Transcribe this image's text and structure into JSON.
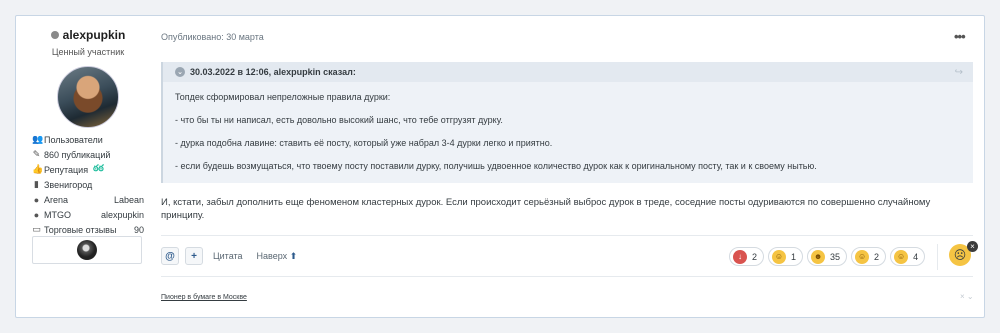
{
  "author": {
    "name": "alexpupkin",
    "title": "Ценный участник"
  },
  "stats": [
    {
      "icon": "users-icon",
      "glyph": "👥",
      "label": "Пользователи",
      "value": ""
    },
    {
      "icon": "comments-icon",
      "glyph": "✎",
      "label": "860 публикаций",
      "value": ""
    },
    {
      "icon": "thumbs-up-icon",
      "glyph": "👍",
      "label": "Репутация",
      "value": "",
      "badge": "ఠఠ"
    },
    {
      "icon": "building-icon",
      "glyph": "▮",
      "label": "Звенигород",
      "value": ""
    },
    {
      "icon": "user-icon",
      "glyph": "●",
      "label": "Arena",
      "value": "Labean"
    },
    {
      "icon": "user-icon",
      "glyph": "●",
      "label": "MTGO",
      "value": "alexpupkin"
    },
    {
      "icon": "id-card-icon",
      "glyph": "▭",
      "label": "Торговые отзывы",
      "value": "90"
    }
  ],
  "post": {
    "meta": "Опубликовано: 30 марта",
    "more": "•••",
    "quote": {
      "header": "30.03.2022 в 12:06, alexpupkin сказал:",
      "paragraphs": [
        "Топдек сформировал непреложные правила дурки:",
        "- что бы ты ни написал, есть довольно высокий шанс, что тебе отгрузят дурку.",
        "- дурка подобна лавине: ставить её посту, который уже набрал 3-4 дурки легко и приятно.",
        "- если будешь возмущаться, что твоему посту поставили дурку, получишь удвоенное количество дурок как к оригинальному посту, так и к своему нытью."
      ]
    },
    "text": "И, кстати, забыл дополнить еще феноменом кластерных дурок. Если происходит серьёзный выброс дурок в треде, соседние посты одуриваются по совершенно случайному принципу.",
    "actions": {
      "mention": "@",
      "plus": "+",
      "quote_label": "Цитата",
      "top_label": "Наверх"
    },
    "reactions": [
      {
        "icon": "downvote-icon",
        "glyph": "↓",
        "color": "#d9534f",
        "count": "2"
      },
      {
        "icon": "facepalm-icon",
        "glyph": "☺",
        "color": "#f5c443",
        "count": "1"
      },
      {
        "icon": "crazy-face-icon",
        "glyph": "☻",
        "color": "#f5c443",
        "count": "35"
      },
      {
        "icon": "crying-laugh-icon",
        "glyph": "☺",
        "color": "#f5c443",
        "count": "2"
      },
      {
        "icon": "laugh-icon",
        "glyph": "☺",
        "color": "#f5c443",
        "count": "4"
      }
    ],
    "react_close": "×",
    "signature": "Пионер в бумаге в Москве",
    "signature_control": "× ⌄"
  }
}
